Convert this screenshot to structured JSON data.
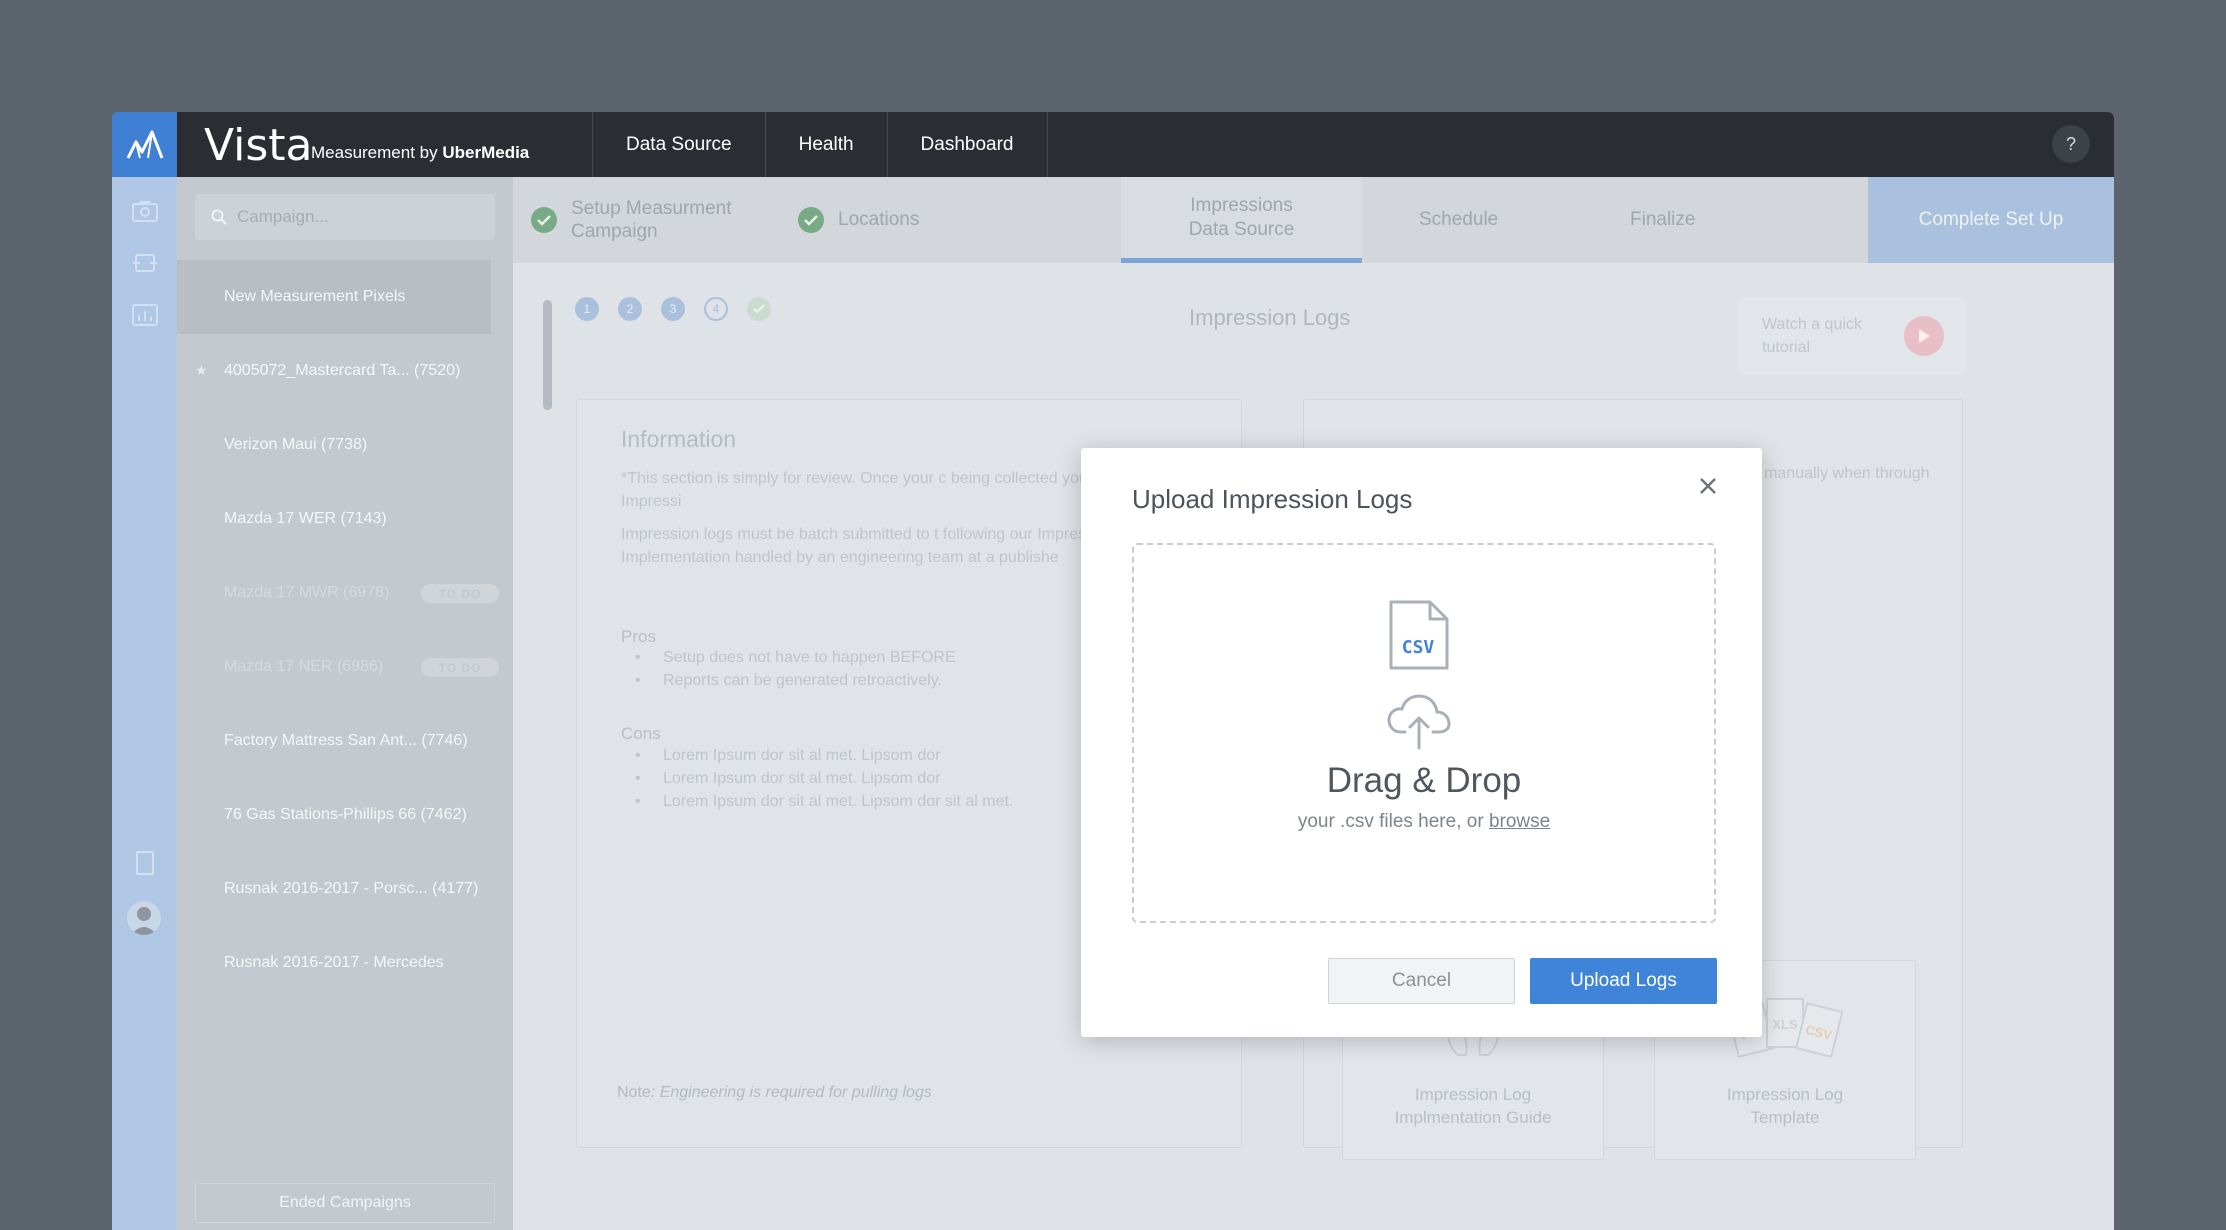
{
  "app": {
    "brand": "Vista",
    "brand_sub_prefix": "Measurement by ",
    "brand_sub_company": "UberMedia",
    "help_label": "?"
  },
  "nav": [
    "Data Source",
    "Health",
    "Dashboard"
  ],
  "search": {
    "placeholder": "Campaign..."
  },
  "campaigns": [
    {
      "label": "New Measurement Pixels",
      "selected": true
    },
    {
      "label": "4005072_Mastercard Ta... (7520)",
      "starred": true
    },
    {
      "label": "Verizon Maui (7738)"
    },
    {
      "label": "Mazda 17 WER (7143)"
    },
    {
      "label": "Mazda 17 MWR (6978)",
      "badge": "TO DO"
    },
    {
      "label": "Mazda 17 NER (6986)",
      "badge": "TO DO"
    },
    {
      "label": "Factory Mattress San Ant... (7746)"
    },
    {
      "label": "76 Gas Stations-Phillips 66 (7462)"
    },
    {
      "label": "Rusnak 2016-2017 - Porsc... (4177)"
    },
    {
      "label": "Rusnak 2016-2017 - Mercedes"
    }
  ],
  "ended_campaigns": "Ended Campaigns",
  "steps": {
    "setup": "Setup Measurment Campaign",
    "locations": "Locations",
    "impressions_line1": "Impressions",
    "impressions_line2": "Data Source",
    "schedule": "Schedule",
    "finalize": "Finalize",
    "complete": "Complete Set Up"
  },
  "step_dots": [
    "1",
    "2",
    "3",
    "4"
  ],
  "content": {
    "section_title": "Impression Logs",
    "tutorial": "Watch a quick tutorial",
    "info_title": "Information",
    "info_p1": "*This section is simply for review. Once your c being collected you can submit your Impressi",
    "info_p2": "Impression logs must be batch submitted to t following our Impression Log Implementation handled by an engineering team at a publishe",
    "pros_title": "Pros",
    "pros": [
      "Setup does not have to happen BEFORE",
      "Reports can be generated retroactively."
    ],
    "cons_title": "Cons",
    "cons": [
      "Lorem Ipsum dor sit al met. Lipsom dor",
      "Lorem Ipsum dor sit al met. Lipsom dor",
      "Lorem Ipsum dor sit al met. Lipsom dor sit al met."
    ],
    "note_label": "Note",
    "note_text": ": Engineering is required for pulling logs",
    "right_text": "gs. Upload Logs manually when through an API request.",
    "resource1": "Impression Log Implmentation Guide",
    "resource2": "Impression Log Template"
  },
  "modal": {
    "title": "Upload Impression Logs",
    "file_icon_text": "CSV",
    "drag_title": "Drag & Drop",
    "drag_sub": "your .csv files here, or ",
    "browse": "browse",
    "cancel": "Cancel",
    "upload": "Upload Logs"
  },
  "colors": {
    "accent": "#3f84d9",
    "topbar": "#2a2d32",
    "check": "#78aa87"
  }
}
